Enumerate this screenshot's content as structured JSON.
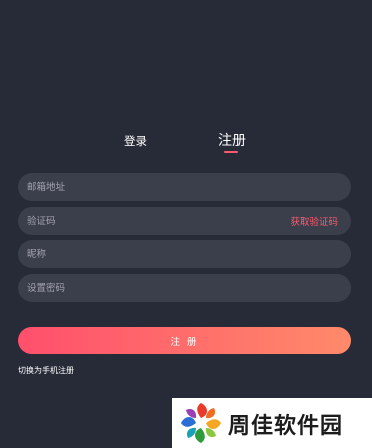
{
  "tabs": {
    "login_label": "登录",
    "register_label": "注册",
    "active": "register",
    "accent_color": "#ff5a6e"
  },
  "form": {
    "email_placeholder": "邮箱地址",
    "code_placeholder": "验证码",
    "get_code_label": "获取验证码",
    "nickname_placeholder": "昵称",
    "password_placeholder": "设置密码",
    "submit_label": "注 册",
    "switch_label": "切换为手机注册"
  },
  "colors": {
    "background": "#272b38",
    "field_background": "#3b3e4b",
    "gradient_start": "#ff4f6c",
    "gradient_end": "#ff8a6a"
  },
  "watermark": {
    "text": "周佳软件园",
    "icon": "pinwheel-logo-icon"
  }
}
